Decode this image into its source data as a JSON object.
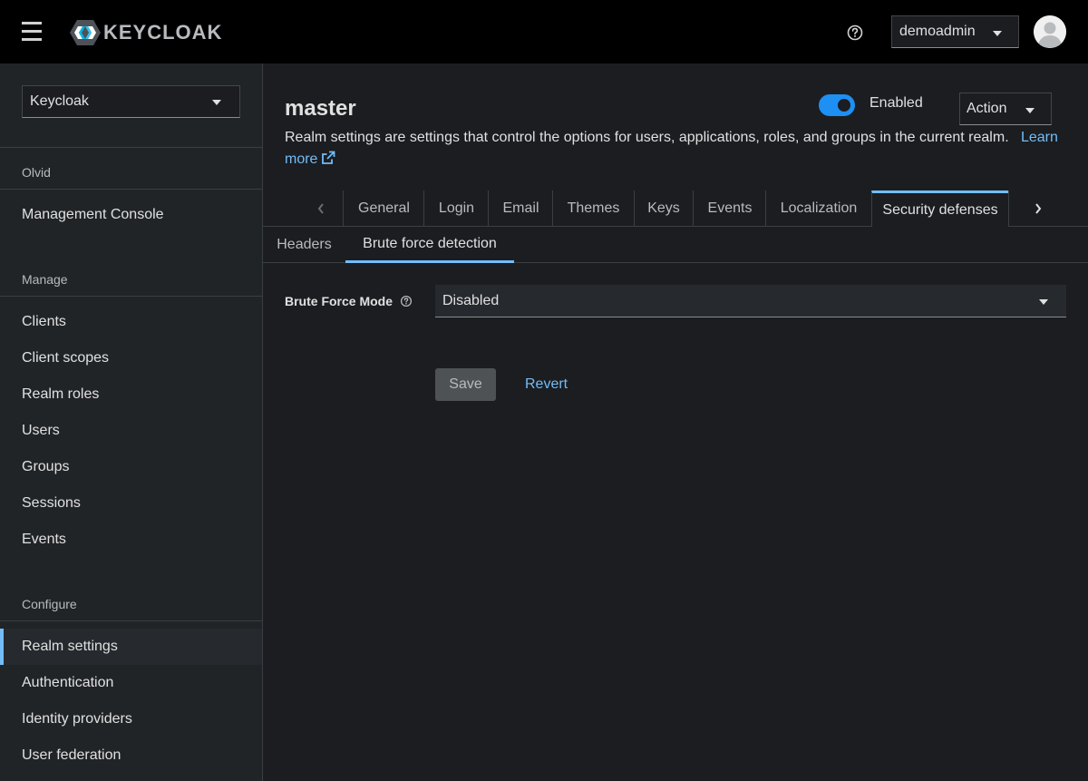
{
  "masthead": {
    "logo_text": "KEYCLOAK",
    "help_icon": "help-circle-icon",
    "user_menu": "demoadmin"
  },
  "sidebar": {
    "realm_selector": "Keycloak",
    "groups": {
      "olvid": "Olvid",
      "manage": "Manage",
      "configure": "Configure"
    },
    "items": {
      "management_console": "Management Console",
      "clients": "Clients",
      "client_scopes": "Client scopes",
      "realm_roles": "Realm roles",
      "users": "Users",
      "groups": "Groups",
      "sessions": "Sessions",
      "events": "Events",
      "realm_settings": "Realm settings",
      "authentication": "Authentication",
      "identity_providers": "Identity providers",
      "user_federation": "User federation"
    }
  },
  "main": {
    "title": "master",
    "enabled_label": "Enabled",
    "enabled": true,
    "action_label": "Action",
    "description": "Realm settings are settings that control the options for users, applications, roles, and groups in the current realm.",
    "learn_more_1": "Learn",
    "learn_more_2": "more",
    "tabs": {
      "general": "General",
      "login": "Login",
      "email": "Email",
      "themes": "Themes",
      "keys": "Keys",
      "events": "Events",
      "localization": "Localization",
      "security_defenses": "Security defenses"
    },
    "active_tab": "Security defenses",
    "subtabs": {
      "headers": "Headers",
      "brute_force": "Brute force detection"
    },
    "active_subtab": "Brute force detection",
    "form": {
      "brute_force_mode_label": "Brute Force Mode",
      "brute_force_mode_value": "Disabled",
      "save": "Save",
      "revert": "Revert"
    }
  },
  "colors": {
    "accent": "#73bcf7",
    "toggle_on": "#1e8ff3",
    "masthead_bg": "#000000",
    "sidebar_bg": "#212427",
    "main_bg": "#1b1d21"
  }
}
